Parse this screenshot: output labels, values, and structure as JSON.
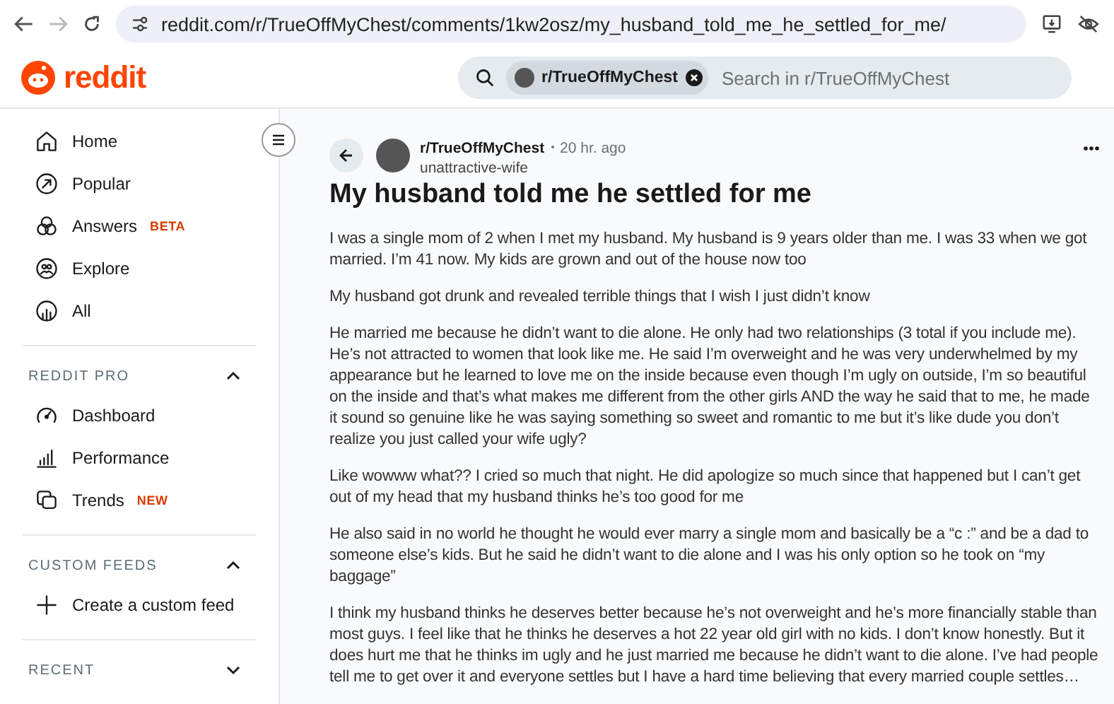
{
  "browser": {
    "url": "reddit.com/r/TrueOffMyChest/comments/1kw2osz/my_husband_told_me_he_settled_for_me/"
  },
  "header": {
    "logo": "reddit",
    "search": {
      "chip": "r/TrueOffMyChest",
      "placeholder": "Search in r/TrueOffMyChest"
    }
  },
  "sidebar": {
    "items": [
      {
        "label": "Home"
      },
      {
        "label": "Popular"
      },
      {
        "label": "Answers",
        "badge": "BETA"
      },
      {
        "label": "Explore"
      },
      {
        "label": "All"
      }
    ],
    "sections": [
      {
        "title": "REDDIT PRO",
        "expanded": true,
        "items": [
          {
            "label": "Dashboard"
          },
          {
            "label": "Performance"
          },
          {
            "label": "Trends",
            "badge": "NEW"
          }
        ]
      },
      {
        "title": "CUSTOM FEEDS",
        "expanded": true,
        "items": [
          {
            "label": "Create a custom feed"
          }
        ]
      },
      {
        "title": "RECENT",
        "expanded": false
      }
    ]
  },
  "post": {
    "subreddit": "r/TrueOffMyChest",
    "time": "20 hr. ago",
    "author": "unattractive-wife",
    "title": "My husband told me he settled for me",
    "paragraphs": [
      "I was a single mom of 2 when I met my husband. My husband is 9 years older than me. I was 33 when we got married. I’m 41 now. My kids are grown and out of the house now too",
      "My husband got drunk and revealed terrible things that I wish I just didn’t know",
      "He married me because he didn’t want to die alone. He only had two relationships (3 total if you include me). He’s not attracted to women that look like me. He said I’m overweight and he was very underwhelmed by my appearance but he learned to love me on the inside because even though I’m ugly on outside, I’m so beautiful on the inside and that’s what makes me different from the other girls AND the way he said that to me, he made it sound so genuine like he was saying something so sweet and romantic to me but it’s like dude you don’t realize you just called your wife ugly?",
      "Like wowww what?? I cried so much that night. He did apologize so much since that happened but I can’t get out of my head that my husband thinks he’s too good for me",
      "He also said in no world he thought he would ever marry a single mom and basically be a “c   :” and be a dad to someone else’s kids. But he said he didn’t want to die alone and I was his only option so he took on “my baggage”",
      "I think my husband thinks he deserves better because he’s not overweight and he’s more financially stable than most guys. I feel like that he thinks he deserves a hot 22 year old girl with no kids. I don’t know honestly. But it does hurt me that he thinks im ugly and he just married me because he didn’t want to die alone. I’ve had people tell me to get over it and everyone settles but I have a hard time believing that every married couple settles…"
    ]
  }
}
